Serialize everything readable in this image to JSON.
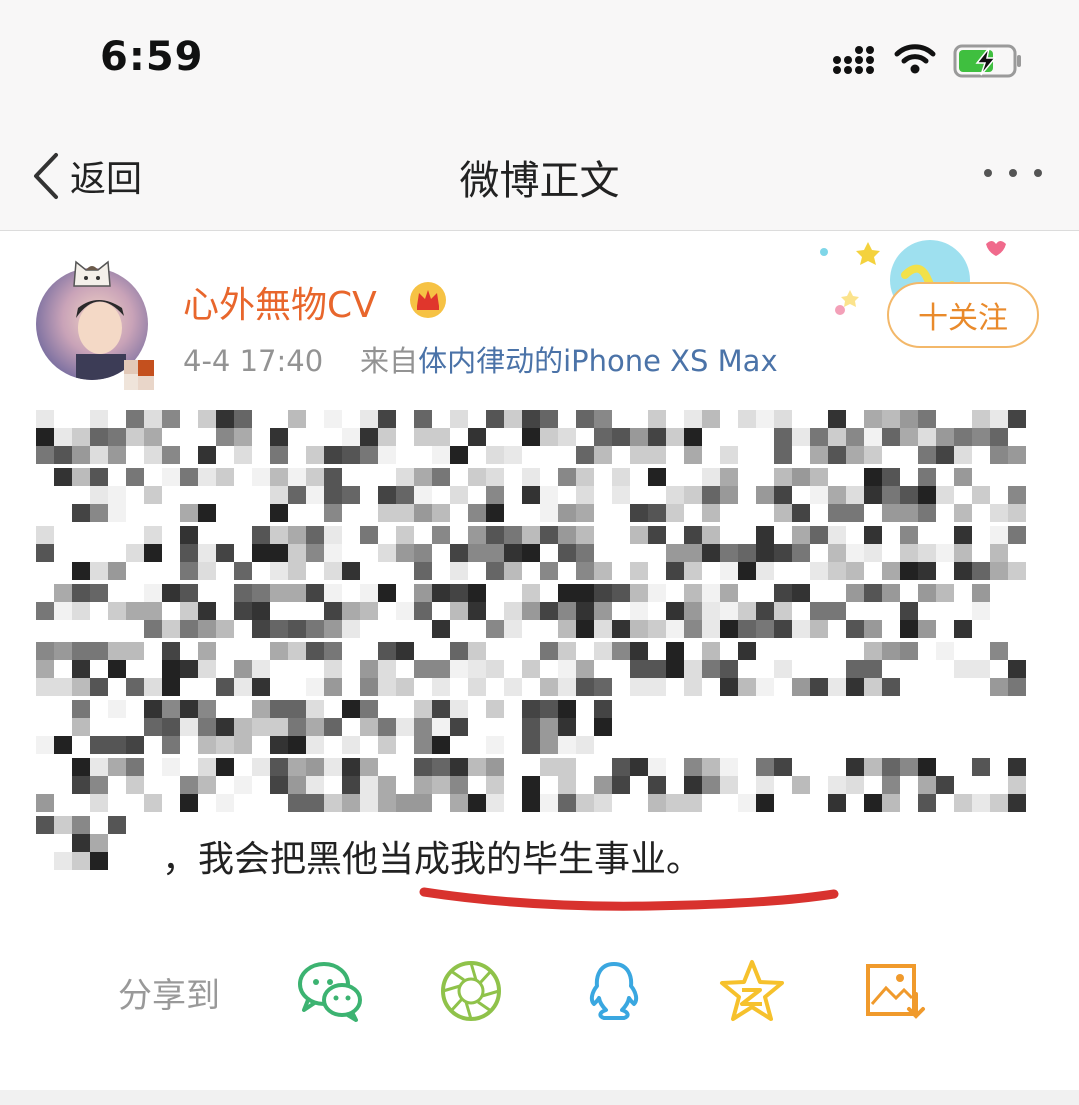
{
  "status_bar": {
    "time": "6:59"
  },
  "nav": {
    "back_label": "返回",
    "title": "微博正文"
  },
  "post": {
    "author": "心外無物CV",
    "time": "4-4 17:40",
    "source_prefix": "来自",
    "source": "体内律动的iPhone XS Max",
    "follow_label": "十关注",
    "visible_text": "，我会把黑他当成我的毕生事业。"
  },
  "share": {
    "label": "分享到"
  },
  "colors": {
    "username": "#e8662c",
    "source_link": "#4b73a8",
    "follow": "#e98a2b",
    "underline": "#d8322e"
  }
}
